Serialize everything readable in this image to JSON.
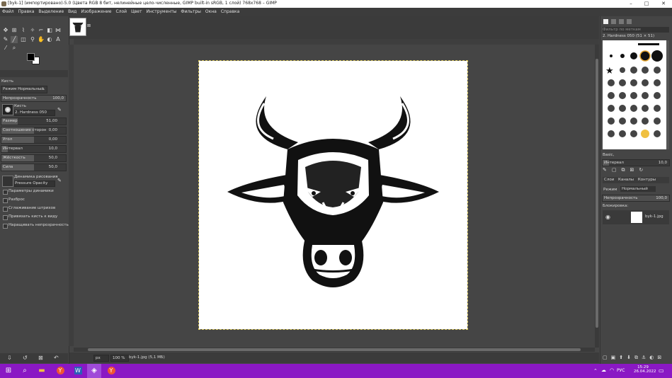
{
  "window": {
    "title": "[byk-1] (импортировано)-5.0 (Цвета RGB 8 бит, нелинейные цело-численные, GIMP built-in sRGB, 1 слой) 768x768 – GIMP",
    "min": "–",
    "max": "□",
    "close": "✕"
  },
  "menu": [
    "Файл",
    "Правка",
    "Выделение",
    "Вид",
    "Изображение",
    "Слой",
    "Цвет",
    "Инструменты",
    "Фильтры",
    "Окна",
    "Справка"
  ],
  "tool_options": {
    "header": "Кисть",
    "mode_label": "Режим",
    "mode_value": "Нормальный",
    "opacity_label": "Непрозрачность",
    "opacity_value": "100,0",
    "brush_label": "Кисть",
    "brush_value": "2. Hardness 050",
    "sliders": [
      {
        "label": "Размер",
        "value": "51,00",
        "fraction": 0.25
      },
      {
        "label": "Соотношение сторон",
        "value": "0,00",
        "fraction": 0.5
      },
      {
        "label": "Угол",
        "value": "0,00",
        "fraction": 0.5
      },
      {
        "label": "Интервал",
        "value": "10,0",
        "fraction": 0.1
      },
      {
        "label": "Жёсткость",
        "value": "50,0",
        "fraction": 0.5
      },
      {
        "label": "Сила",
        "value": "50,0",
        "fraction": 0.5
      }
    ],
    "dynamics_label": "Динамика рисования",
    "dynamics_value": "Pressure Opacity",
    "checks": [
      "Параметры динамики",
      "Разброс",
      "Сглаживание штрихов",
      "Привязать кисть к виду",
      "Наращивать непрозрачность"
    ]
  },
  "canvas": {
    "status_unit": "px",
    "zoom": "100 %",
    "status_text": "byk-1.jpg (5,1 МБ)"
  },
  "brushes": {
    "filter_placeholder": "Фильтр по меткам",
    "selected": "2. Hardness 050 (51 × 51)",
    "tag": "Basic,",
    "spacing_label": "Интервал",
    "spacing_value": "10,0"
  },
  "layers": {
    "tabs": [
      "Слои",
      "Каналы",
      "Контуры"
    ],
    "mode_label": "Режим",
    "mode_value": "Нормальный",
    "opacity_label": "Непрозрачность",
    "opacity_value": "100,0",
    "lock_label": "Блокировка:",
    "items": [
      {
        "name": "byk-1.jpg"
      }
    ]
  },
  "taskbar": {
    "lang": "РУС",
    "time": "15:29",
    "date": "26.04.2022"
  }
}
